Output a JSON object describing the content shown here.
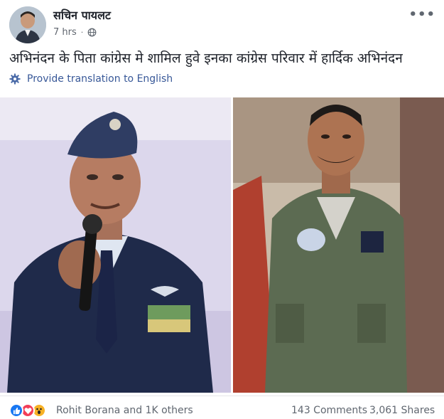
{
  "post": {
    "author": "सचिन पायलट",
    "time": "7 hrs",
    "separator": "·",
    "privacy_icon": "globe-icon",
    "more_icon": "more-options-icon",
    "more_text": "•••",
    "status_text": "अभिनंदन के पिता कांग्रेस मे शामिल हुवे इनका कांग्रेस परिवार में हार्दिक अभिनंदन",
    "translate_label": "Provide translation to English",
    "translate_icon": "gear-icon"
  },
  "photos": {
    "left_icon": "photo-man-in-air-force-cap-with-microphone",
    "right_icon": "photo-pilot-in-flight-suit"
  },
  "footer": {
    "reactions": [
      "like-icon",
      "love-icon",
      "wow-icon"
    ],
    "reactors_text": "Rohit Borana and 1K others",
    "comments_text": "143 Comments",
    "shares_text": "3,061 Shares"
  },
  "colors": {
    "link": "#385898",
    "text": "#1d2129",
    "muted": "#606770",
    "like": "#1877f2",
    "love": "#f33e58",
    "wow": "#f7b125"
  }
}
